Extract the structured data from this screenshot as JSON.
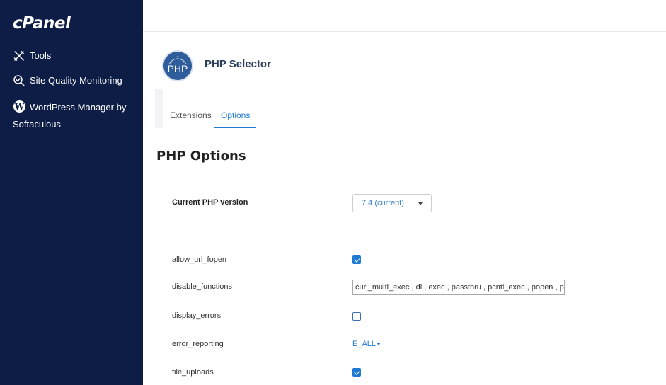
{
  "sidebar": {
    "logo": "cPanel",
    "items": [
      {
        "label": "Tools",
        "icon": "tools-icon"
      },
      {
        "label": "Site Quality Monitoring",
        "icon": "site-quality-icon"
      },
      {
        "label": "WordPress Manager by Softaculous",
        "icon": "wordpress-icon"
      }
    ]
  },
  "header": {
    "logo_text": "PHP",
    "title": "PHP Selector"
  },
  "tabs": [
    {
      "label": "Extensions",
      "active": false
    },
    {
      "label": "Options",
      "active": true
    }
  ],
  "section": {
    "title": "PHP Options"
  },
  "version": {
    "label": "Current PHP version",
    "selected": "7.4 (current)"
  },
  "options": [
    {
      "name": "allow_url_fopen",
      "type": "checkbox",
      "checked": true
    },
    {
      "name": "disable_functions",
      "type": "text",
      "value": "curl_multi_exec , dl , exec , passthru , pcntl_exec , popen , posix_l"
    },
    {
      "name": "display_errors",
      "type": "checkbox",
      "checked": false
    },
    {
      "name": "error_reporting",
      "type": "dropdown",
      "value": "E_ALL"
    },
    {
      "name": "file_uploads",
      "type": "checkbox",
      "checked": true
    }
  ],
  "colors": {
    "sidebar_bg": "#0d1d45",
    "accent": "#1f7ad3",
    "title_text": "#2b3e5c"
  }
}
